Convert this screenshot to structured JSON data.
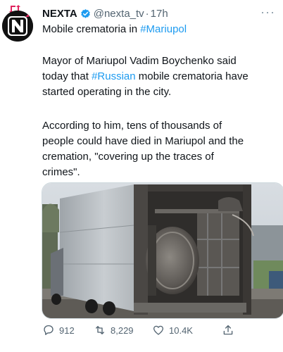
{
  "tweet": {
    "author_name": "NEXTA",
    "author_handle": "@nexta_tv",
    "separator": "·",
    "time": "17h",
    "more_label": "···",
    "title_prefix": "Mobile crematoria in ",
    "title_hashtag": "#Mariupol",
    "paragraph1": {
      "line1": "Mayor of Mariupol Vadim Boychenko said",
      "line2": "today that ",
      "line2_hashtag": "#Russian",
      "line2_suffix": " mobile crematoria have",
      "line3": "started operating in the city."
    },
    "paragraph2": {
      "line1": "According to him, tens of thousands of",
      "line2": "people could have died in Mariupol and the",
      "line3": "cremation, \"covering up the traces of",
      "line4": "crimes\"."
    },
    "avatar_letter": "N"
  },
  "actions": {
    "reply_count": "912",
    "retweet_count": "8,229",
    "like_count": "10.4K"
  },
  "icons": {
    "retweeted": "retweet-icon",
    "verified": "verified-badge-icon",
    "reply": "reply-icon",
    "retweet": "retweet-icon",
    "like": "heart-icon",
    "share": "share-icon"
  },
  "colors": {
    "link": "#1d9bf0",
    "muted": "#536471",
    "avatar_bg": "#111111",
    "avatar_accent": "#e0245e"
  }
}
